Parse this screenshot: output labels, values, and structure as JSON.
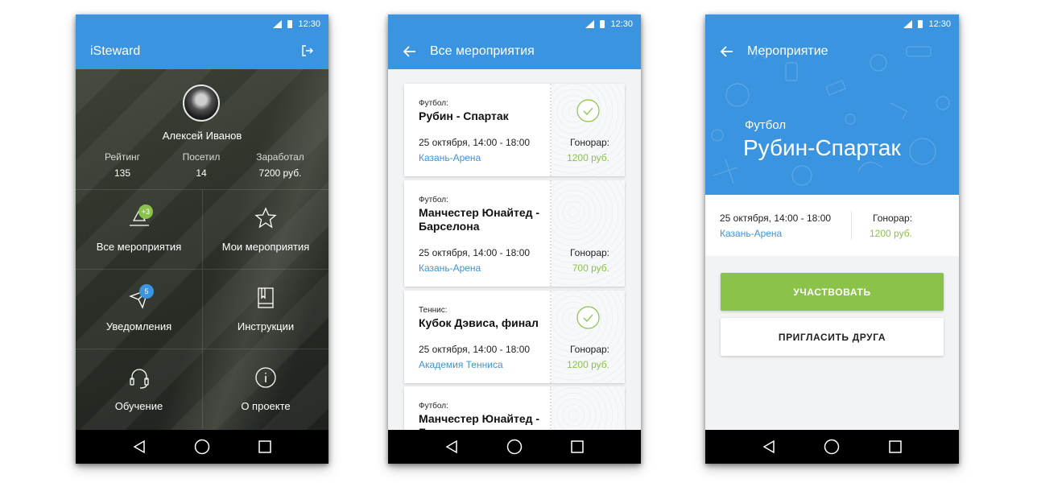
{
  "status": {
    "time": "12:30"
  },
  "screen1": {
    "app_title": "iSteward",
    "user_name": "Алексей Иванов",
    "stats": [
      {
        "label": "Рейтинг",
        "value": "135"
      },
      {
        "label": "Посетил",
        "value": "14"
      },
      {
        "label": "Заработал",
        "value": "7200 руб."
      }
    ],
    "menu": [
      {
        "label": "Все мероприятия",
        "icon": "events-icon",
        "badge": "+3"
      },
      {
        "label": "Мои мероприятия",
        "icon": "star-icon",
        "badge": ""
      },
      {
        "label": "Уведомления",
        "icon": "paper-plane-icon",
        "badge": "5"
      },
      {
        "label": "Инструкции",
        "icon": "book-icon",
        "badge": ""
      },
      {
        "label": "Обучение",
        "icon": "headset-icon",
        "badge": ""
      },
      {
        "label": "О проекте",
        "icon": "info-icon",
        "badge": ""
      }
    ]
  },
  "screen2": {
    "title": "Все мероприятия",
    "events": [
      {
        "sport": "Футбол:",
        "match": "Рубин - Спартак",
        "date": "25 октября, 14:00 - 18:00",
        "venue": "Казань-Арена",
        "fee_label": "Гонорар:",
        "fee": "1200 руб.",
        "checked": true
      },
      {
        "sport": "Футбол:",
        "match": "Манчестер Юнайтед - Барселона",
        "date": "25 октября, 14:00 - 18:00",
        "venue": "Казань-Арена",
        "fee_label": "Гонорар:",
        "fee": "700 руб.",
        "checked": false
      },
      {
        "sport": "Теннис:",
        "match": "Кубок Дэвиса, финал",
        "date": "25 октября, 14:00 - 18:00",
        "venue": "Академия Тенниса",
        "fee_label": "Гонорар:",
        "fee": "1200 руб.",
        "checked": true
      },
      {
        "sport": "Футбол:",
        "match": "Манчестер Юнайтед - Барселона",
        "date": "",
        "venue": "",
        "fee_label": "",
        "fee": "",
        "checked": false
      }
    ]
  },
  "screen3": {
    "title": "Мероприятие",
    "sport": "Футбол",
    "match": "Рубин-Спартак",
    "date": "25 октября, 14:00 - 18:00",
    "venue": "Казань-Арена",
    "fee_label": "Гонорар:",
    "fee": "1200 руб.",
    "participate_button": "УЧАСТВОВАТЬ",
    "invite_button": "ПРИГЛАСИТЬ ДРУГА"
  },
  "colors": {
    "primary": "#3a94e0",
    "accent": "#8bc34a",
    "nav": "#000000"
  }
}
